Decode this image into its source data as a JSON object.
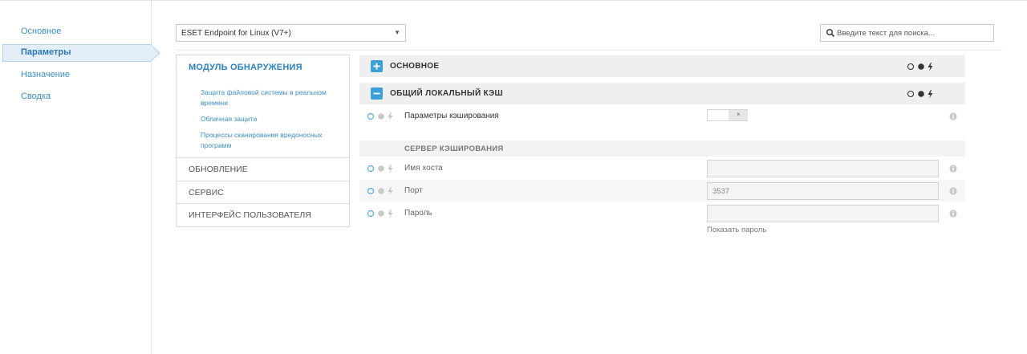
{
  "nav": {
    "items": [
      {
        "label": "Основное"
      },
      {
        "label": "Параметры"
      },
      {
        "label": "Назначение"
      },
      {
        "label": "Сводка"
      }
    ]
  },
  "product_select": {
    "value": "ESET Endpoint for Linux (V7+)",
    "caret": "▼"
  },
  "search": {
    "placeholder": "Введите текст для поиска..."
  },
  "categories": {
    "active": {
      "label": "МОДУЛЬ ОБНАРУЖЕНИЯ",
      "subitems": [
        "Защита файловой системы в реальном времени",
        "Облачная защита",
        "Процессы сканирования вредоносных программ"
      ]
    },
    "others": [
      "ОБНОВЛЕНИЕ",
      "СЕРВИС",
      "ИНТЕРФЕЙС ПОЛЬЗОВАТЕЛЯ"
    ]
  },
  "sections": {
    "basic": {
      "title": "ОСНОВНОЕ",
      "state": "collapsed"
    },
    "cache": {
      "title": "ОБЩИЙ ЛОКАЛЬНЫЙ КЭШ",
      "state": "expanded",
      "caching_param": {
        "label": "Параметры кэширования",
        "toggle_mark": "×"
      },
      "server_title": "СЕРВЕР КЭШИРОВАНИЯ",
      "hostname": {
        "label": "Имя хоста",
        "value": ""
      },
      "port": {
        "label": "Порт",
        "value": "3537"
      },
      "password": {
        "label": "Пароль",
        "value": "",
        "show_label": "Показать пароль"
      }
    }
  },
  "colors": {
    "accent": "#3aa0d8",
    "link": "#3b8ec7",
    "active_bg": "#e3eef8"
  },
  "icons": [
    "search-icon",
    "plus-icon",
    "minus-icon",
    "policy-apply-icon",
    "policy-force-icon",
    "lightning-icon",
    "info-icon"
  ]
}
